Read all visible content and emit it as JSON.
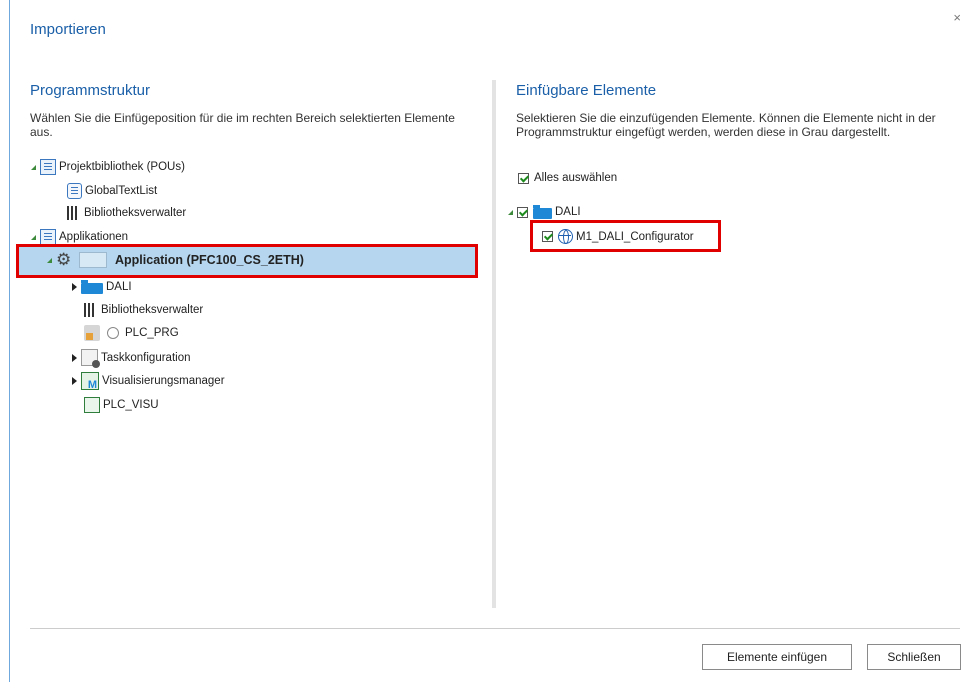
{
  "dialog": {
    "title": "Importieren",
    "close_symbol": "×"
  },
  "left": {
    "title": "Programmstruktur",
    "description": "Wählen Sie die Einfügeposition für die im rechten Bereich selektierten Elemente aus.",
    "tree": {
      "projektbibliothek": "Projektbibliothek (POUs)",
      "global_text_list": "GlobalTextList",
      "bibliotheksverwalter_1": "Bibliotheksverwalter",
      "applikationen": "Applikationen",
      "application": "Application (PFC100_CS_2ETH)",
      "dali": "DALI",
      "bibliotheksverwalter_2": "Bibliotheksverwalter",
      "plc_prg": "PLC_PRG",
      "taskkonfiguration": "Taskkonfiguration",
      "visualisierungsmanager": "Visualisierungsmanager",
      "plc_visu": "PLC_VISU"
    }
  },
  "right": {
    "title": "Einfügbare Elemente",
    "description": "Selektieren Sie die einzufügenden Elemente. Können die Elemente nicht in der Programmstruktur eingefügt werden, werden diese in Grau dargestellt.",
    "select_all": "Alles auswählen",
    "tree": {
      "dali": "DALI",
      "m1_dali_configurator": "M1_DALI_Configurator"
    }
  },
  "buttons": {
    "insert": "Elemente einfügen",
    "close": "Schließen"
  },
  "colors": {
    "accent": "#1a5fa8",
    "highlight_box": "#e00000",
    "selection": "#b5d6ee"
  },
  "icons": [
    "folder-pou-icon",
    "textlist-icon",
    "library-icon",
    "applications-folder-icon",
    "gear-icon",
    "application-icon",
    "folder-icon",
    "cfc-icon",
    "radio-icon",
    "task-icon",
    "visu-manager-icon",
    "plc-visu-icon",
    "checkbox-icon",
    "globe-icon",
    "close-icon"
  ]
}
